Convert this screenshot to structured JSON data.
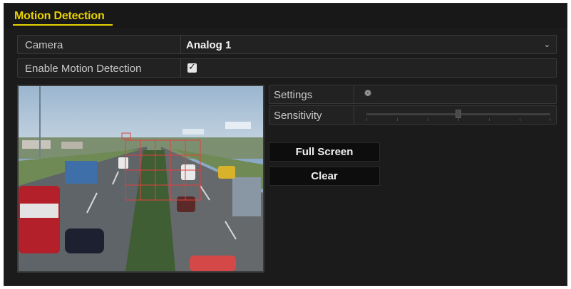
{
  "title": "Motion Detection",
  "camera": {
    "label": "Camera",
    "value": "Analog 1"
  },
  "enable_motion": {
    "label": "Enable Motion Detection",
    "checked": true
  },
  "settings": {
    "label": "Settings"
  },
  "sensitivity": {
    "label": "Sensitivity",
    "level": 0.5
  },
  "buttons": {
    "full_screen": "Full Screen",
    "clear": "Clear"
  },
  "colors": {
    "title": "#e9d200",
    "motion_grid": "#e04040"
  }
}
